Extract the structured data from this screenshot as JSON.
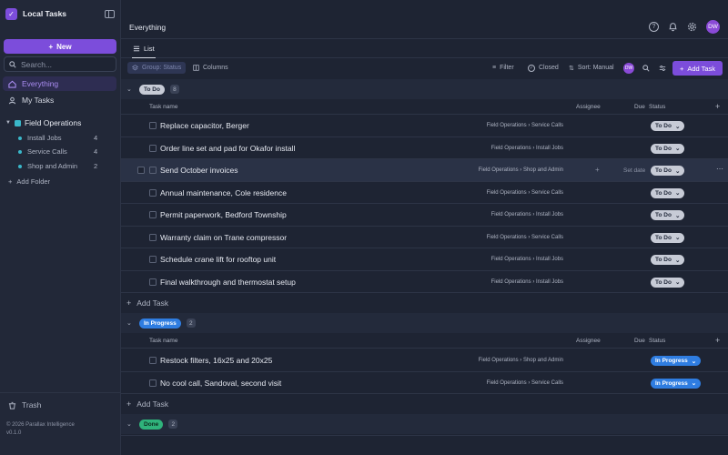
{
  "sidebar": {
    "app_name": "Local Tasks",
    "new_label": "New",
    "search_placeholder": "Search...",
    "nav": [
      {
        "label": "Everything",
        "icon": "home-icon"
      },
      {
        "label": "My Tasks",
        "icon": "user-icon"
      }
    ],
    "space": {
      "label": "Field Operations",
      "color": "#3ab7c9"
    },
    "lists": [
      {
        "label": "Install Jobs",
        "count": "4"
      },
      {
        "label": "Service Calls",
        "count": "4"
      },
      {
        "label": "Shop and Admin",
        "count": "2"
      }
    ],
    "add_folder": "Add Folder",
    "trash": "Trash",
    "copyright": "© 2026 Parallax Intelligence",
    "version": "v0.1.0"
  },
  "header": {
    "title": "Everything",
    "avatar_initials": "DW",
    "tab": "List"
  },
  "toolbar": {
    "group": "Group: Status",
    "columns": "Columns",
    "filter": "Filter",
    "closed": "Closed",
    "sort": "Sort: Manual",
    "avatar_initials": "DW",
    "add_task": "Add Task"
  },
  "columns": {
    "task_name": "Task name",
    "assignee": "Assignee",
    "due": "Due",
    "status": "Status"
  },
  "groups": {
    "todo": {
      "label": "To Do",
      "count": "8",
      "tasks": [
        {
          "name": "Replace capacitor, Berger",
          "path": "Field Operations › Service Calls",
          "status": "To Do"
        },
        {
          "name": "Order line set and pad for Okafor install",
          "path": "Field Operations › Install Jobs",
          "status": "To Do"
        },
        {
          "name": "Send October invoices",
          "path": "Field Operations › Shop and Admin",
          "status": "To Do",
          "due": "Set date"
        },
        {
          "name": "Annual maintenance, Cole residence",
          "path": "Field Operations › Service Calls",
          "status": "To Do"
        },
        {
          "name": "Permit paperwork, Bedford Township",
          "path": "Field Operations › Install Jobs",
          "status": "To Do"
        },
        {
          "name": "Warranty claim on Trane compressor",
          "path": "Field Operations › Service Calls",
          "status": "To Do"
        },
        {
          "name": "Schedule crane lift for rooftop unit",
          "path": "Field Operations › Install Jobs",
          "status": "To Do"
        },
        {
          "name": "Final walkthrough and thermostat setup",
          "path": "Field Operations › Install Jobs",
          "status": "To Do"
        }
      ]
    },
    "inprogress": {
      "label": "In Progress",
      "count": "2",
      "tasks": [
        {
          "name": "Restock filters, 16x25 and 20x25",
          "path": "Field Operations › Shop and Admin",
          "status": "In Progress"
        },
        {
          "name": "No cool call, Sandoval, second visit",
          "path": "Field Operations › Service Calls",
          "status": "In Progress"
        }
      ]
    },
    "done": {
      "label": "Done",
      "count": "2"
    }
  },
  "add_task_row": "Add Task",
  "colors": {
    "accent": "#7c4ddb",
    "todo": "#c7cbd6",
    "in_progress": "#2f7de1",
    "done": "#2fb37b"
  }
}
